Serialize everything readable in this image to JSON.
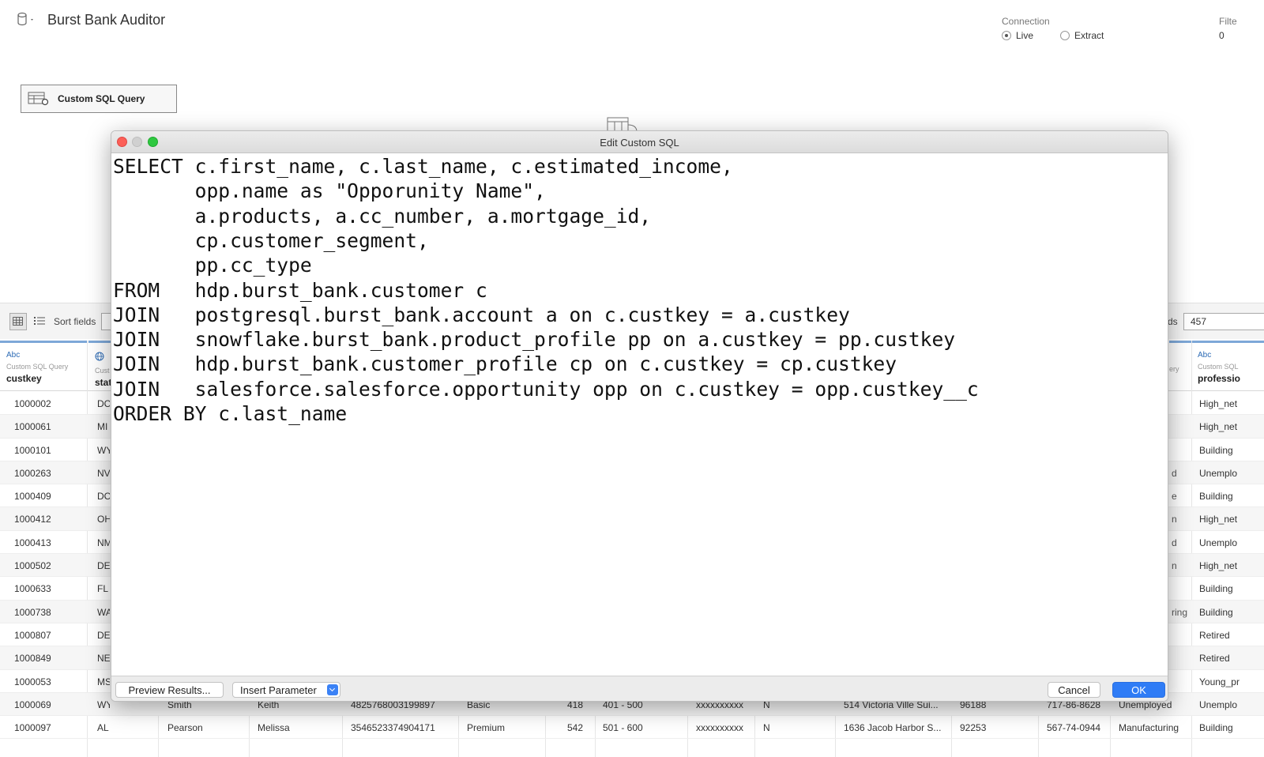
{
  "header": {
    "title": "Burst Bank Auditor",
    "connection_label": "Connection",
    "connection_options": [
      "Live",
      "Extract"
    ],
    "connection_selected": "Live",
    "filters_label": "Filte",
    "filters_count": "0"
  },
  "canvas": {
    "source_label": "Custom SQL Query"
  },
  "grid_toolbar": {
    "sort_label": "Sort fields",
    "rows_label": "ds",
    "rows_value": "457"
  },
  "grid_columns": [
    {
      "type": "Abc",
      "source": "Custom SQL Query",
      "name": "custkey"
    },
    {
      "type": "globe",
      "source": "Cust",
      "name": "stat"
    },
    {
      "type": "Abc",
      "source": "Custom SQL",
      "name": "professio",
      "source_partial": "ery"
    }
  ],
  "grid_rows": [
    {
      "custkey": "1000002",
      "state": "DC",
      "tail": "",
      "prof": "High_net"
    },
    {
      "custkey": "1000061",
      "state": "MI",
      "tail": "",
      "prof": "High_net"
    },
    {
      "custkey": "1000101",
      "state": "WY",
      "tail": "",
      "prof": "Building"
    },
    {
      "custkey": "1000263",
      "state": "NV",
      "tail": "d",
      "prof": "Unemplo"
    },
    {
      "custkey": "1000409",
      "state": "DC",
      "tail": "e",
      "prof": "Building"
    },
    {
      "custkey": "1000412",
      "state": "OH",
      "tail": "n",
      "prof": "High_net"
    },
    {
      "custkey": "1000413",
      "state": "NM",
      "tail": "d",
      "prof": "Unemplo"
    },
    {
      "custkey": "1000502",
      "state": "DE",
      "tail": "n",
      "prof": "High_net"
    },
    {
      "custkey": "1000633",
      "state": "FL",
      "tail": "",
      "prof": "Building"
    },
    {
      "custkey": "1000738",
      "state": "WA",
      "tail": "ring",
      "prof": "Building"
    },
    {
      "custkey": "1000807",
      "state": "DE",
      "tail": "",
      "prof": "Retired"
    },
    {
      "custkey": "1000849",
      "state": "NE",
      "tail": "",
      "prof": "Retired"
    },
    {
      "custkey": "1000053",
      "state": "MS",
      "tail": "",
      "prof": "Young_pr"
    },
    {
      "custkey": "1000069",
      "state": "WY",
      "last": "Smith",
      "first": "Keith",
      "cc": "4825768003199897",
      "product": "Basic",
      "score": "418",
      "range": "401 - 500",
      "mort": "xxxxxxxxxx",
      "flag": "N",
      "addr": "514 Victoria Ville Sui...",
      "zip": "96188",
      "phone": "717-86-8628",
      "occ": "Unemployed",
      "prof": "Unemplo"
    },
    {
      "custkey": "1000097",
      "state": "AL",
      "last": "Pearson",
      "first": "Melissa",
      "cc": "3546523374904171",
      "product": "Premium",
      "score": "542",
      "range": "501 - 600",
      "mort": "xxxxxxxxxx",
      "flag": "N",
      "addr": "1636 Jacob Harbor S...",
      "zip": "92253",
      "phone": "567-74-0944",
      "occ": "Manufacturing",
      "prof": "Building"
    }
  ],
  "dialog": {
    "title": "Edit Custom SQL",
    "sql_lines": [
      "SELECT c.first_name, c.last_name, c.estimated_income,",
      "       opp.name as \"Opporunity Name\",",
      "       a.products, a.cc_number, a.mortgage_id,",
      "       cp.customer_segment,",
      "       pp.cc_type",
      "FROM   hdp.burst_bank.customer c",
      "JOIN   postgresql.burst_bank.account a on c.custkey = a.custkey",
      "JOIN   snowflake.burst_bank.product_profile pp on a.custkey = pp.custkey",
      "JOIN   hdp.burst_bank.customer_profile cp on c.custkey = cp.custkey",
      "JOIN   salesforce.salesforce.opportunity opp on c.custkey = opp.custkey__c",
      "ORDER BY c.last_name"
    ],
    "preview_label": "Preview Results...",
    "insert_param_label": "Insert Parameter",
    "cancel_label": "Cancel",
    "ok_label": "OK"
  }
}
